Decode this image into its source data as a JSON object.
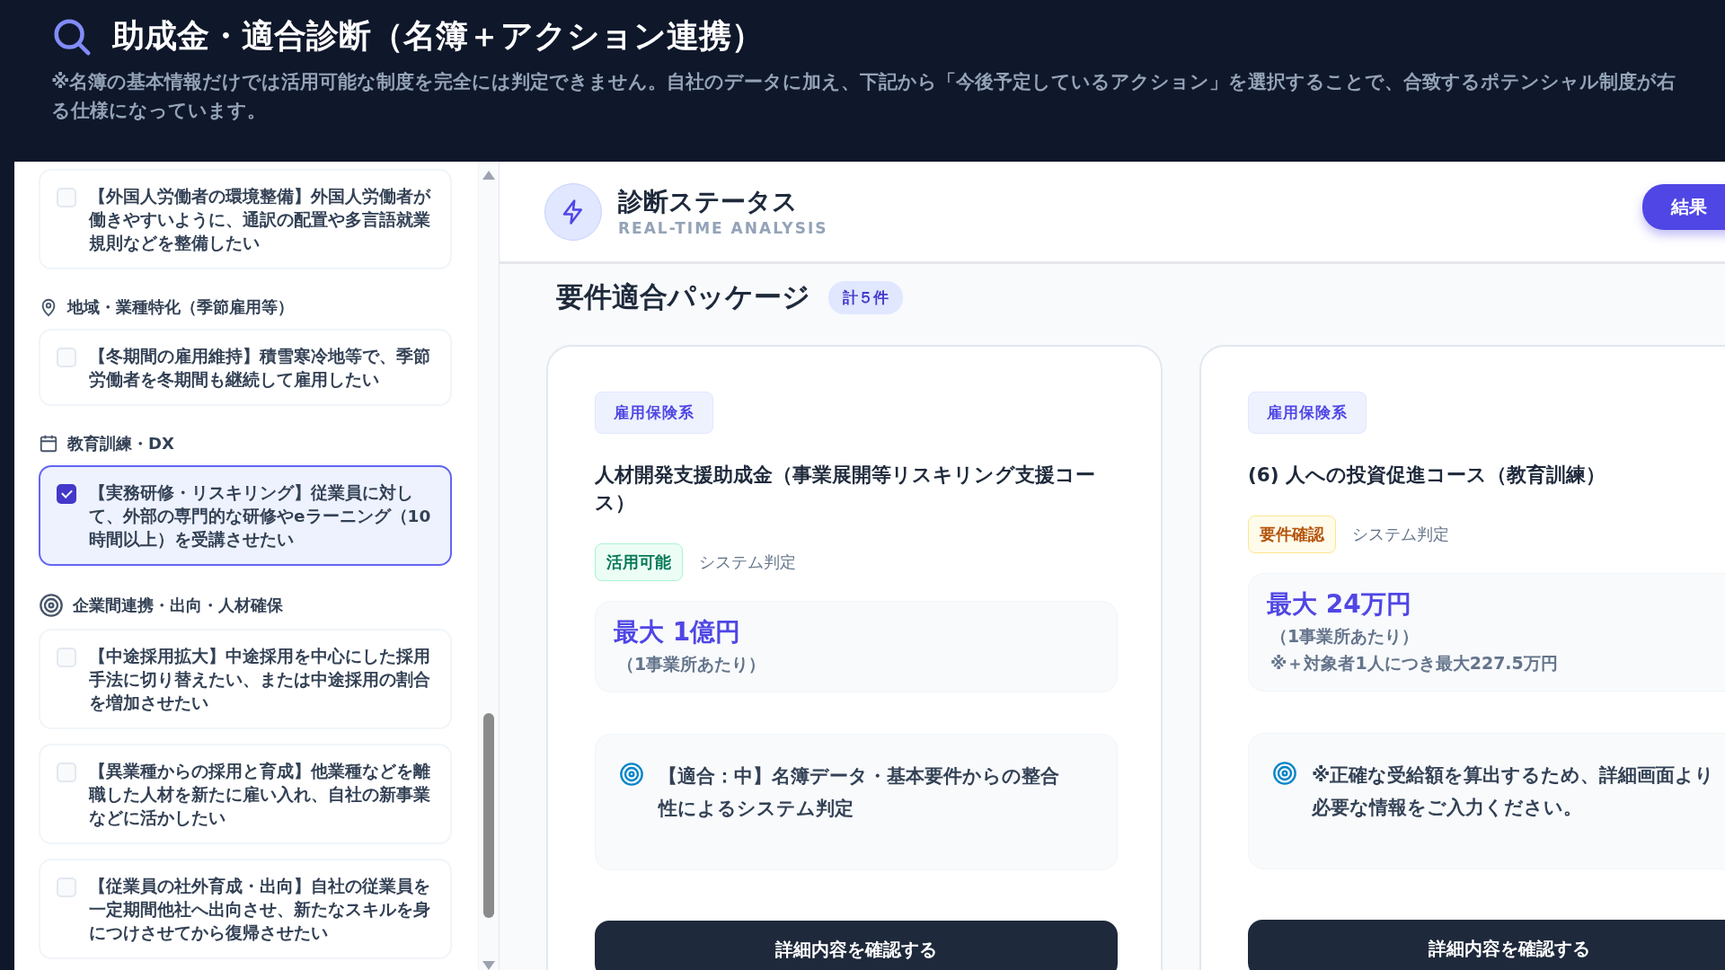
{
  "header": {
    "title": "助成金・適合診断（名簿＋アクション連携）",
    "description_lines": [
      "※名簿の基本情報だけでは活用可能な制度を完全には判定できません。自社のデータに加え、下記から「今後予定しているアクション」を選択することで、合致するポテンシャル制度が右",
      "る仕様になっています。"
    ]
  },
  "sidebar": {
    "groups": [
      {
        "items": [
          {
            "text": "【外国人労働者の環境整備】外国人労働者が働きやすいように、通訳の配置や多言語就業規則などを整備したい",
            "checked": false
          }
        ]
      },
      {
        "title": "地域・業種特化（季節雇用等）",
        "items": [
          {
            "text": "【冬期間の雇用維持】積雪寒冷地等で、季節労働者を冬期間も継続して雇用したい",
            "checked": false
          }
        ]
      },
      {
        "title": "教育訓練・DX",
        "items": [
          {
            "text": "【実務研修・リスキリング】従業員に対して、外部の専門的な研修やeラーニング（10時間以上）を受講させたい",
            "checked": true
          }
        ]
      },
      {
        "title": "企業間連携・出向・人材確保",
        "items": [
          {
            "text": "【中途採用拡大】中途採用を中心にした採用手法に切り替えたい、または中途採用の割合を増加させたい",
            "checked": false
          },
          {
            "text": "【異業種からの採用と育成】他業種などを離職した人材を新たに雇い入れ、自社の新事業などに活かしたい",
            "checked": false
          },
          {
            "text": "【従業員の社外育成・出向】自社の従業員を一定期間他社へ出向させ、新たなスキルを身につけさせてから復帰させたい",
            "checked": false
          }
        ]
      }
    ]
  },
  "status": {
    "title": "診断ステータス",
    "subtitle": "REAL-TIME ANALYSIS",
    "button": "結果"
  },
  "packages": {
    "heading": "要件適合パッケージ",
    "count": "計５件",
    "cards": [
      {
        "category": "雇用保険系",
        "title": "人材開発支援助成金（事業展開等リスキリング支援コース）",
        "status": {
          "label": "活用可能",
          "kind": "available"
        },
        "judgement": "システム判定",
        "amount": "最大 1億円",
        "amount_note": "（1事業所あたり）",
        "match_note": "【適合：中】名簿データ・基本要件からの整合性によるシステム判定",
        "button": "詳細内容を確認する"
      },
      {
        "category": "雇用保険系",
        "title": "(6) 人への投資促進コース（教育訓練）",
        "status": {
          "label": "要件確認",
          "kind": "check"
        },
        "judgement": "システム判定",
        "amount": "最大 24万円",
        "amount_note": "（1事業所あたり）",
        "extra_note": "※＋対象者1人につき最大227.5万円",
        "match_note": "※正確な受給額を算出するため、詳細画面より必要な情報をご入力ください。",
        "button": "詳細内容を確認する"
      }
    ]
  }
}
